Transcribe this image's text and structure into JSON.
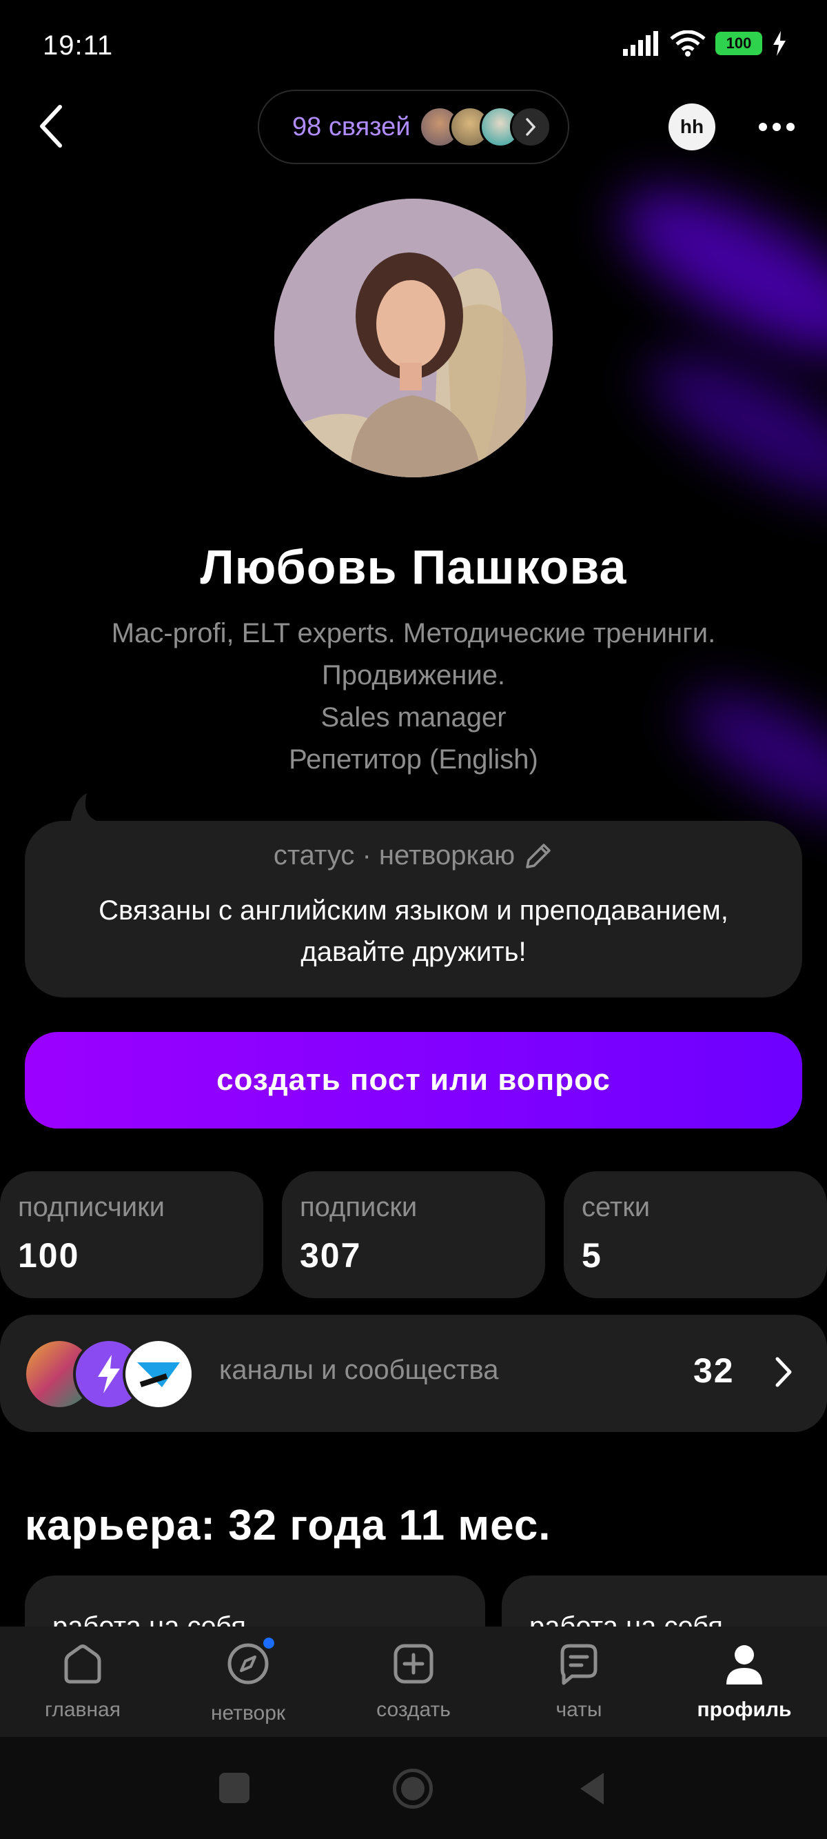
{
  "status_bar": {
    "time": "19:11",
    "battery": "100"
  },
  "header": {
    "connections_label": "98 связей",
    "hh_badge": "hh"
  },
  "profile": {
    "name": "Любовь Пашкова",
    "bio_lines": [
      "Mac-profi, ELT experts. Методические тренинги.",
      "Продвижение.",
      "Sales manager",
      "Репетитор (English)"
    ]
  },
  "status": {
    "header": "статус · нетворкаю",
    "text": "Связаны с английским языком и преподаванием, давайте дружить!"
  },
  "cta": {
    "label": "создать пост или вопрос"
  },
  "stats": [
    {
      "label": "подписчики",
      "value": "100"
    },
    {
      "label": "подписки",
      "value": "307"
    },
    {
      "label": "сетки",
      "value": "5"
    }
  ],
  "channels": {
    "label": "каналы и сообщества",
    "count": "32"
  },
  "career": {
    "title": "карьера: 32 года 11 мес.",
    "cards": [
      "работа на себя",
      "работа на себя"
    ]
  },
  "nav": {
    "items": [
      {
        "label": "главная",
        "icon": "home-icon"
      },
      {
        "label": "нетворк",
        "icon": "compass-icon"
      },
      {
        "label": "создать",
        "icon": "plus-square-icon"
      },
      {
        "label": "чаты",
        "icon": "chat-icon"
      },
      {
        "label": "профиль",
        "icon": "profile-icon"
      }
    ],
    "active": "профиль"
  },
  "colors": {
    "accent": "#8a00ff",
    "link": "#b08cff",
    "card": "#1f1f1f",
    "notification_dot": "#1a6dff"
  }
}
